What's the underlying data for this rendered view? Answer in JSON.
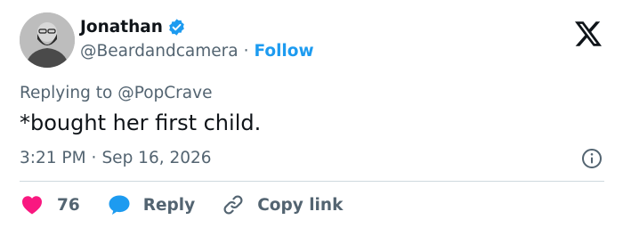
{
  "author": {
    "name": "Jonathan",
    "handle": "@Beardandcamera",
    "separator": "·",
    "follow_label": "Follow",
    "verified": true
  },
  "reply_context": {
    "prefix": "Replying to",
    "mention": "@PopCrave"
  },
  "tweet": {
    "text": "*bought her first child.",
    "time": "3:21 PM",
    "separator": "·",
    "date": "Sep 16, 2026"
  },
  "actions": {
    "like_count": "76",
    "reply_label": "Reply",
    "copy_link_label": "Copy link"
  },
  "colors": {
    "accent": "#1d9bf0",
    "like": "#f91880",
    "muted": "#536471",
    "text": "#0f1419",
    "divider": "#cfd9de"
  },
  "icons": [
    "verified-badge-icon",
    "x-logo-icon",
    "info-icon",
    "heart-icon",
    "reply-bubble-icon",
    "link-icon"
  ]
}
